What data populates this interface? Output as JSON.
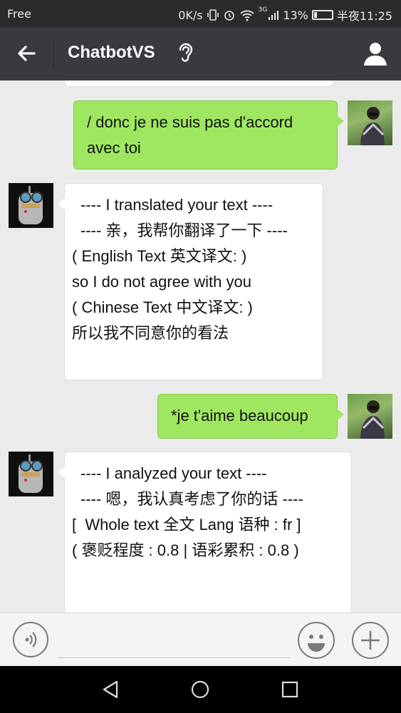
{
  "status_bar": {
    "carrier": "Free",
    "speed": "0K/s",
    "network": "3G",
    "battery": "13%",
    "time": "半夜11:25"
  },
  "header": {
    "title": "ChatbotVS",
    "back_icon": "arrow-left-icon",
    "listen_icon": "ear-icon",
    "profile_icon": "user-icon"
  },
  "messages": [
    {
      "side": "right",
      "lines": [
        "/ donc je ne suis pas d'accord",
        "avec toi"
      ]
    },
    {
      "side": "left",
      "lines": [
        "---- I translated your text ----",
        "---- 亲，我帮你翻译了一下 ----",
        "",
        "( English Text 英文译文: )",
        "so I do not agree with you",
        "( Chinese Text 中文译文: )",
        "所以我不同意你的看法"
      ]
    },
    {
      "side": "right",
      "lines": [
        "*je t'aime beaucoup"
      ]
    },
    {
      "side": "left",
      "lines": [
        "---- I analyzed your text ----",
        "---- 嗯，我认真考虑了你的话 ----",
        "",
        "[  Whole text 全文 Lang 语种 : fr ]",
        "( 褒贬程度 : 0.8 | 语彩累积 : 0.8 )"
      ]
    }
  ],
  "input_bar": {
    "voice_icon": "voice-icon",
    "emoji_icon": "emoji-icon",
    "plus_icon": "plus-icon"
  },
  "nav_bar": {
    "back_icon": "nav-back-icon",
    "home_icon": "nav-home-icon",
    "recent_icon": "nav-recent-icon"
  },
  "colors": {
    "header_bg": "#393a3f",
    "sent_bubble": "#9fe760",
    "received_bubble": "#ffffff",
    "chat_bg": "#ebebeb"
  }
}
